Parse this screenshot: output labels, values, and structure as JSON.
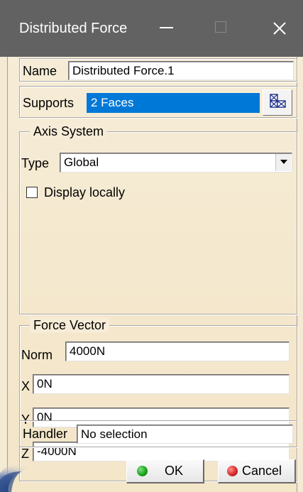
{
  "window": {
    "title": "Distributed Force"
  },
  "name_row": {
    "label": "Name",
    "value": "Distributed Force.1"
  },
  "supports_row": {
    "label": "Supports",
    "value": "2 Faces",
    "selected_bg": "#0078d7"
  },
  "axis_system": {
    "legend": "Axis System",
    "type_label": "Type",
    "type_value": "Global",
    "display_locally_label": "Display locally",
    "display_locally_checked": false
  },
  "force_vector": {
    "legend": "Force Vector",
    "norm_label": "Norm",
    "norm_value": "4000N",
    "x_label": "X",
    "x_value": "0N",
    "y_label": "Y",
    "y_value": "0N",
    "z_label": "Z",
    "z_value": "-4000N"
  },
  "handler_row": {
    "label": "Handler",
    "value": "No selection"
  },
  "buttons": {
    "ok_label": "OK",
    "ok_color": "#1ca51c",
    "cancel_label": "Cancel",
    "cancel_color": "#d82a2a"
  },
  "icons": {
    "minimize": "minimize-icon",
    "maximize": "maximize-icon",
    "close": "close-icon",
    "multi_select": "multi-selection-icon",
    "dropdown": "chevron-down-icon"
  }
}
